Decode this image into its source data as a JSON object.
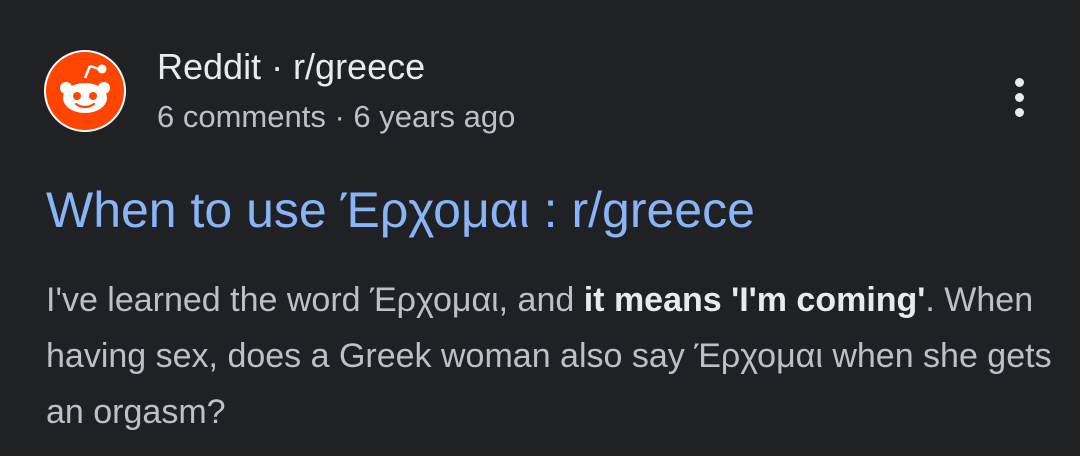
{
  "result": {
    "source": "Reddit · r/greece",
    "meta": "6 comments · 6 years ago",
    "title": "When to use Έρχομαι : r/greece",
    "snippet": {
      "part1": "I've learned the word Έρχομαι, and ",
      "bold": "it means 'I'm coming'",
      "part2": ". When having sex, does a Greek woman also say Έρχομαι when she gets an orgasm?"
    },
    "favicon_icon": "reddit-alien-icon",
    "menu_icon": "more-vert-icon",
    "colors": {
      "background": "#202124",
      "title": "#8ab4f8",
      "text": "#bdc1c6",
      "favicon": "#ff4500"
    }
  }
}
